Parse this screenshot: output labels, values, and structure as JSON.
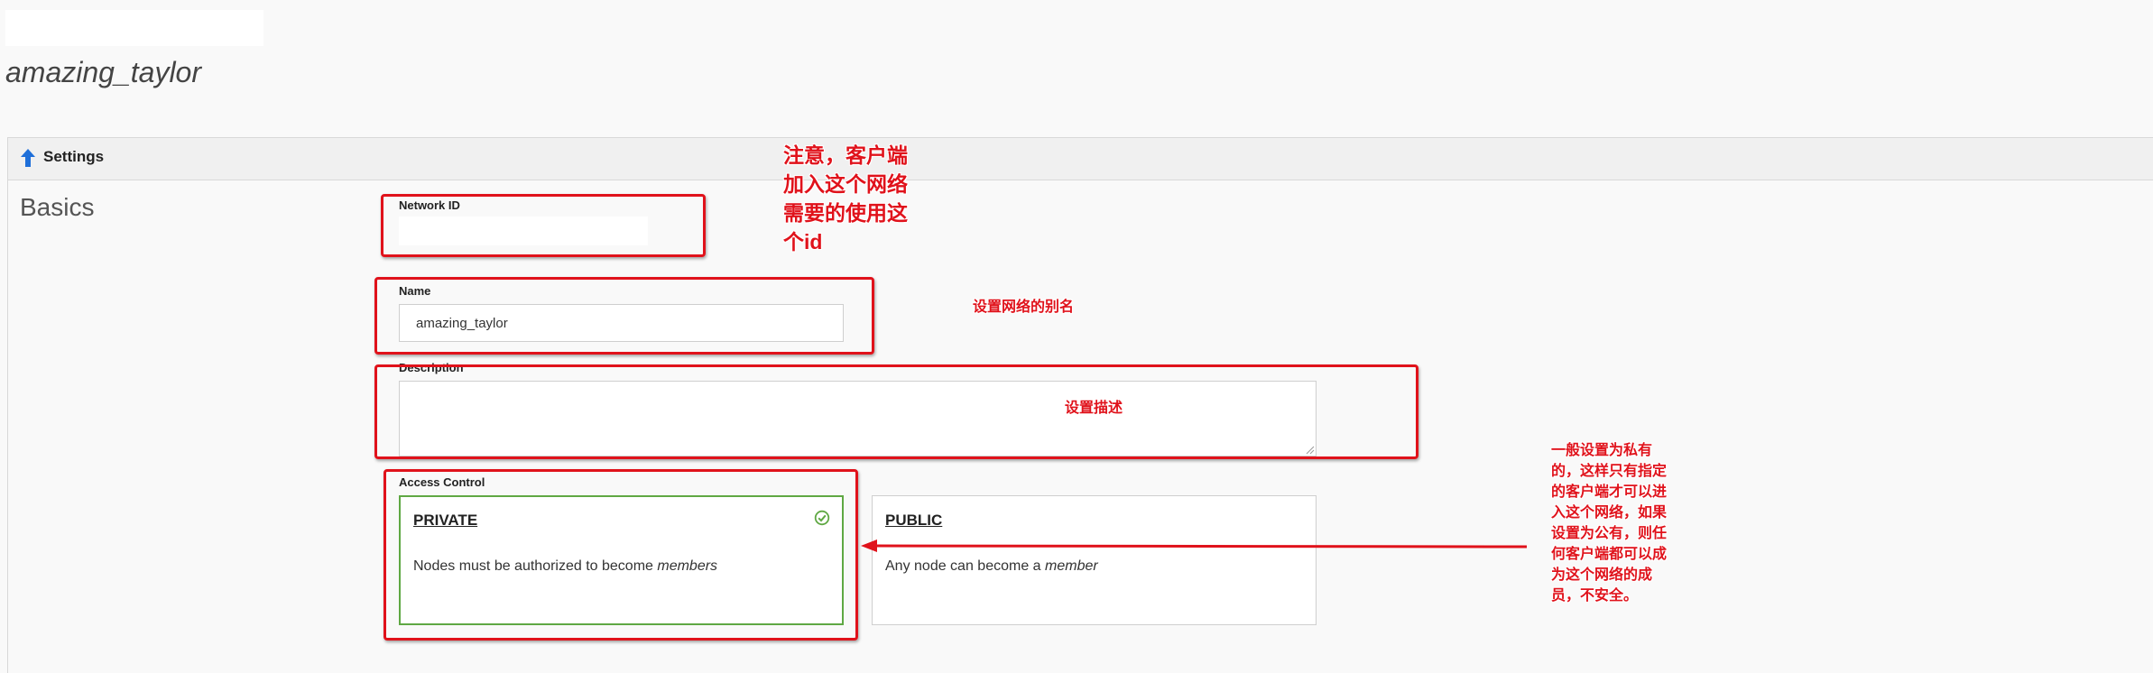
{
  "page": {
    "title": "amazing_taylor"
  },
  "panel": {
    "header_title": "Settings",
    "header_icon": "arrow-up-icon",
    "section_title": "Basics"
  },
  "fields": {
    "network_id_label": "Network ID",
    "name_label": "Name",
    "name_value": "amazing_taylor",
    "description_label": "Description",
    "description_value": ""
  },
  "access_control": {
    "label": "Access Control",
    "selected": "private",
    "private": {
      "title": "PRIVATE",
      "desc_prefix": "Nodes must be authorized to become ",
      "desc_emphasis": "members",
      "selected_icon": "check-circle-icon"
    },
    "public": {
      "title": "PUBLIC",
      "desc_prefix": "Any node can become a ",
      "desc_emphasis": "member"
    }
  },
  "annotations": {
    "color": "#e0121b",
    "network_id_note": "注意，客户端加入这个网络需要的使用这个id",
    "name_note": "设置网络的别名",
    "description_note": "设置描述",
    "access_note": "一般设置为私有的，这样只有指定的客户端才可以进入这个网络，如果设置为公有，则任何客户端都可以成为这个网络的成员，不安全。"
  },
  "colors": {
    "accent_green": "#5fa843",
    "header_icon_blue": "#1e6fd9"
  }
}
